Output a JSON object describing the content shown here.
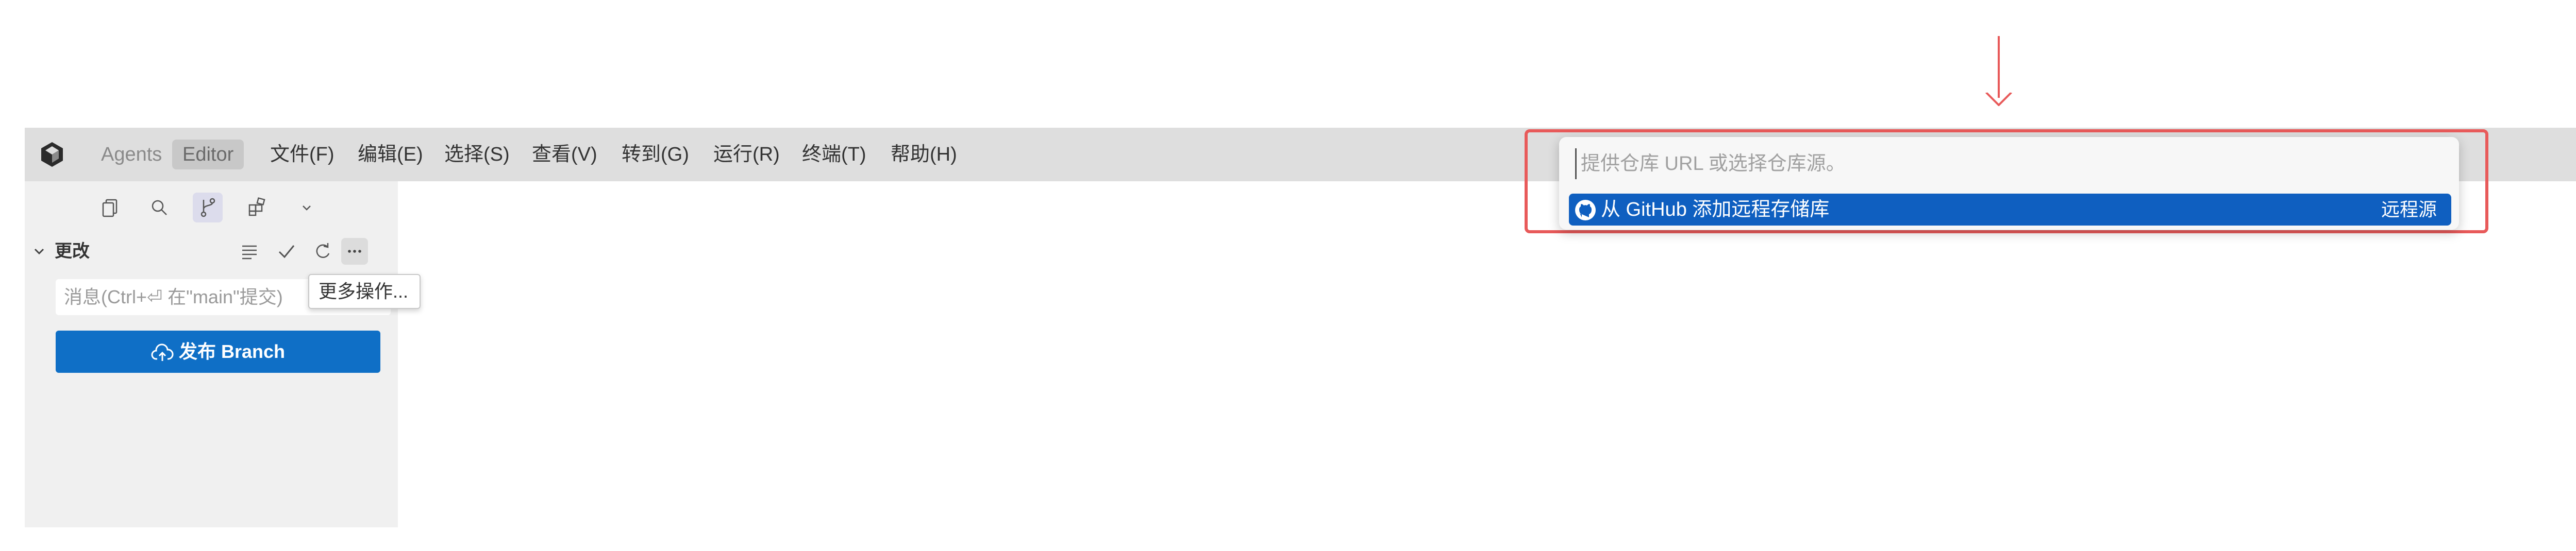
{
  "titlebar": {
    "modes": {
      "agents": "Agents",
      "editor": "Editor"
    },
    "menu": [
      "文件(F)",
      "编辑(E)",
      "选择(S)",
      "查看(V)",
      "转到(G)",
      "运行(R)",
      "终端(T)",
      "帮助(H)"
    ]
  },
  "sidebar": {
    "section_title": "更改",
    "commit_placeholder": "消息(Ctrl+⏎ 在\"main\"提交)",
    "tooltip": "更多操作...",
    "publish_button": "发布 Branch",
    "activity_icons": [
      "explorer-icon",
      "search-icon",
      "source-control-icon",
      "extensions-icon",
      "chevron-down-icon"
    ],
    "section_actions": [
      "view-as-tree-icon",
      "commit-check-icon",
      "refresh-icon",
      "more-actions-icon"
    ]
  },
  "quickpick": {
    "placeholder": "提供仓库 URL 或选择仓库源。",
    "item": {
      "label": "从 GitHub 添加远程存储库",
      "description": "远程源",
      "icon": "github-icon"
    }
  },
  "colors": {
    "accent": "#0f6fc6",
    "selection": "#0f5fc0",
    "annotation": "#e85a5a",
    "titlebar": "#dedede",
    "sidebar": "#f0f0f0"
  }
}
